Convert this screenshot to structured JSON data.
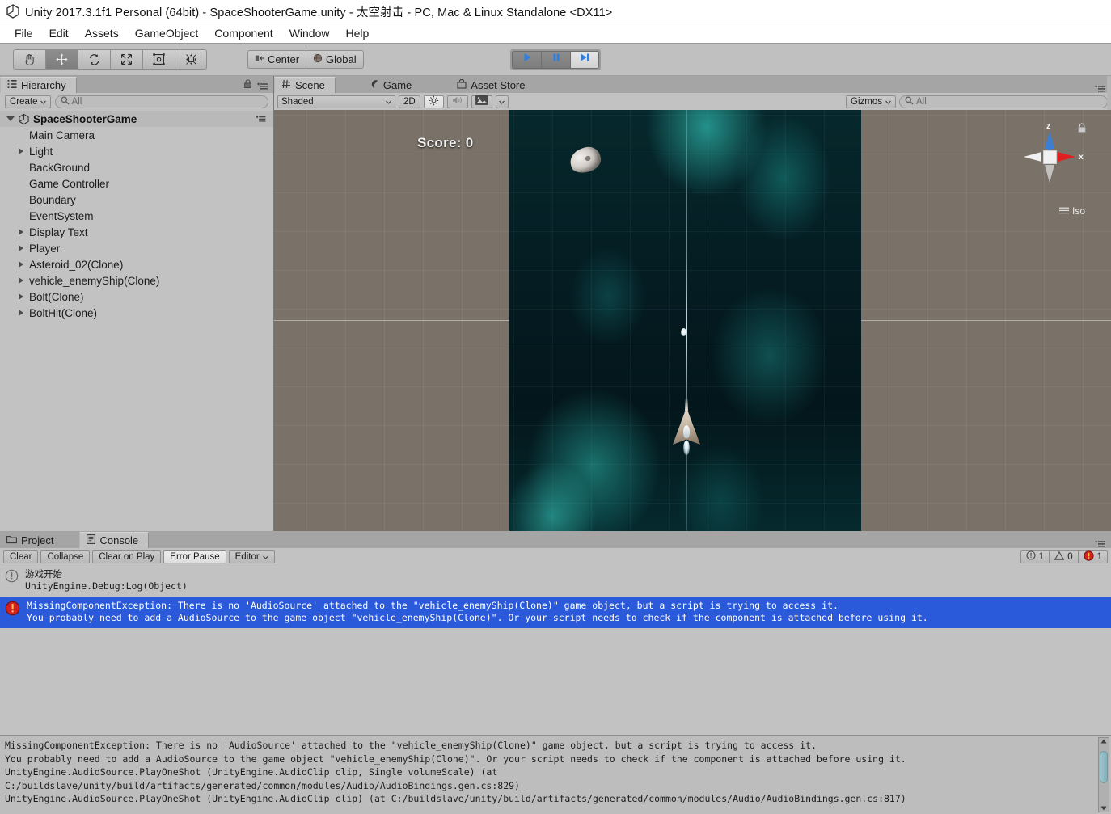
{
  "window": {
    "title": "Unity 2017.3.1f1 Personal (64bit) - SpaceShooterGame.unity - 太空射击 - PC, Mac & Linux Standalone <DX11>",
    "logo_icon": "unity-logo-icon"
  },
  "menubar": {
    "items": [
      "File",
      "Edit",
      "Assets",
      "GameObject",
      "Component",
      "Window",
      "Help"
    ]
  },
  "toolbar": {
    "tools": [
      {
        "name": "hand-tool",
        "icon": "hand-icon",
        "active": false
      },
      {
        "name": "move-tool",
        "icon": "move-icon",
        "active": true
      },
      {
        "name": "rotate-tool",
        "icon": "rotate-icon",
        "active": false
      },
      {
        "name": "scale-tool",
        "icon": "scale-icon",
        "active": false
      },
      {
        "name": "rect-tool",
        "icon": "rect-transform-icon",
        "active": false
      },
      {
        "name": "transform-tool",
        "icon": "transform-icon",
        "active": false
      }
    ],
    "pivot_label": "Center",
    "pivot_icon": "pivot-center-icon",
    "space_label": "Global",
    "space_icon": "globe-icon",
    "play_controls": [
      {
        "name": "play-button",
        "icon": "play-icon",
        "active": false
      },
      {
        "name": "pause-button",
        "icon": "pause-icon",
        "active": false
      },
      {
        "name": "step-button",
        "icon": "step-icon",
        "active": true
      }
    ]
  },
  "hierarchy": {
    "tab_label": "Hierarchy",
    "tab_icon": "hierarchy-icon",
    "lock_icon": "lock-icon",
    "options_icon": "options-menu-icon",
    "create_label": "Create",
    "search_placeholder": "All",
    "search_icon": "search-icon",
    "root": {
      "label": "SpaceShooterGame",
      "icon": "unity-scene-icon",
      "expanded": true
    },
    "items": [
      {
        "label": "Main Camera",
        "expandable": false
      },
      {
        "label": "Light",
        "expandable": true
      },
      {
        "label": "BackGround",
        "expandable": false
      },
      {
        "label": "Game Controller",
        "expandable": false
      },
      {
        "label": "Boundary",
        "expandable": false
      },
      {
        "label": "EventSystem",
        "expandable": false
      },
      {
        "label": "Display Text",
        "expandable": true
      },
      {
        "label": "Player",
        "expandable": true
      },
      {
        "label": "Asteroid_02(Clone)",
        "expandable": true
      },
      {
        "label": "vehicle_enemyShip(Clone)",
        "expandable": true
      },
      {
        "label": "Bolt(Clone)",
        "expandable": true
      },
      {
        "label": "BoltHit(Clone)",
        "expandable": true
      }
    ]
  },
  "scene_panel": {
    "tabs": [
      {
        "label": "Scene",
        "icon": "scene-icon",
        "active": true
      },
      {
        "label": "Game",
        "icon": "game-icon",
        "active": false
      },
      {
        "label": "Asset Store",
        "icon": "asset-store-icon",
        "active": false
      }
    ],
    "options_icon": "options-menu-icon",
    "draw_mode": "Shaded",
    "mode_2d_label": "2D",
    "lighting_icon": "sun-icon",
    "audio_icon": "audio-icon",
    "effects_icon": "image-effects-icon",
    "effects_arrow_icon": "chevron-down-icon",
    "gizmos_label": "Gizmos",
    "gizmos_search_placeholder": "All",
    "gizmo_widget": {
      "axis_z_label": "z",
      "axis_x_label": "x",
      "projection_label": "Iso",
      "lock_icon": "camera-lock-icon",
      "color_z": "#3b7fd4",
      "color_x": "#e02020",
      "color_center": "#f0f0f0"
    },
    "viewport": {
      "score_text": "Score: 0",
      "objects": [
        {
          "name": "asteroid-sprite"
        },
        {
          "name": "player-ship-sprite"
        },
        {
          "name": "bolt-sprite"
        }
      ],
      "background_color": "#7a7268",
      "game_plate_color": "#041c22",
      "nebula_color": "#2fd9c8"
    }
  },
  "console": {
    "tabs": [
      {
        "label": "Project",
        "icon": "folder-icon",
        "active": false
      },
      {
        "label": "Console",
        "icon": "console-icon",
        "active": true
      }
    ],
    "options_icon": "options-menu-icon",
    "buttons": [
      {
        "label": "Clear",
        "name": "clear-button",
        "active": false
      },
      {
        "label": "Collapse",
        "name": "collapse-button",
        "active": false
      },
      {
        "label": "Clear on Play",
        "name": "clear-on-play-button",
        "active": false
      },
      {
        "label": "Error Pause",
        "name": "error-pause-button",
        "active": true
      }
    ],
    "editor_dropdown": "Editor",
    "counters": [
      {
        "icon": "info-icon",
        "count": "1"
      },
      {
        "icon": "warning-icon",
        "count": "0"
      },
      {
        "icon": "error-icon",
        "count": "1"
      }
    ],
    "entries": [
      {
        "icon": "info-icon",
        "line1": "游戏开始",
        "line2": "UnityEngine.Debug:Log(Object)",
        "selected": false
      },
      {
        "icon": "error-icon",
        "line1": "MissingComponentException: There is no 'AudioSource' attached to the \"vehicle_enemyShip(Clone)\" game object, but a script is trying to access it.",
        "line2": "You probably need to add a AudioSource to the game object \"vehicle_enemyShip(Clone)\". Or your script needs to check if the component is attached before using it.",
        "selected": true
      }
    ],
    "stack_trace": "MissingComponentException: There is no 'AudioSource' attached to the \"vehicle_enemyShip(Clone)\" game object, but a script is trying to access it.\nYou probably need to add a AudioSource to the game object \"vehicle_enemyShip(Clone)\". Or your script needs to check if the component is attached before using it.\nUnityEngine.AudioSource.PlayOneShot (UnityEngine.AudioClip clip, Single volumeScale) (at\nC:/buildslave/unity/build/artifacts/generated/common/modules/Audio/AudioBindings.gen.cs:829)\nUnityEngine.AudioSource.PlayOneShot (UnityEngine.AudioClip clip) (at C:/buildslave/unity/build/artifacts/generated/common/modules/Audio/AudioBindings.gen.cs:817)"
  }
}
